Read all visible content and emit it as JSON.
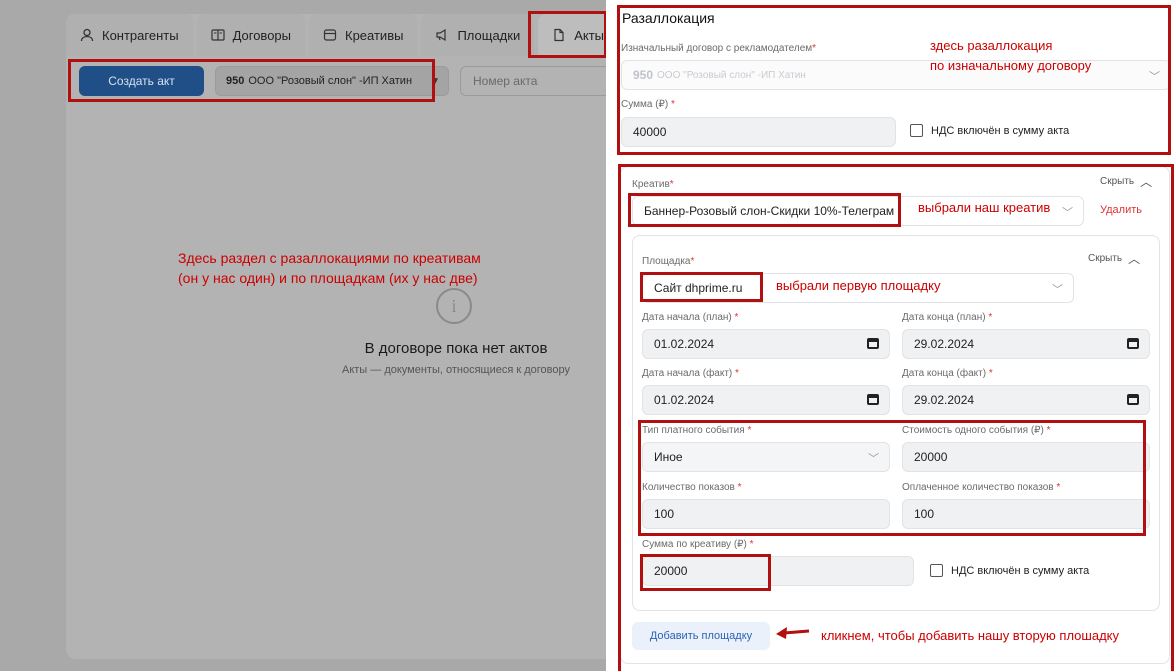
{
  "tabs": [
    {
      "label": "Контрагенты",
      "icon": "person-icon"
    },
    {
      "label": "Договоры",
      "icon": "book-icon"
    },
    {
      "label": "Креативы",
      "icon": "card-icon"
    },
    {
      "label": "Площадки",
      "icon": "megaphone-icon"
    },
    {
      "label": "Акты",
      "icon": "document-icon",
      "active": true
    }
  ],
  "toolbar": {
    "create_label": "Создать акт",
    "contract_id": "950",
    "contract_name": "ООО \"Розовый слон\" -ИП Хатин",
    "act_number_placeholder": "Номер акта"
  },
  "empty": {
    "title": "В договоре пока нет актов",
    "subtitle": "Акты — документы, относящиеся к договору"
  },
  "annotations": {
    "left": "Здесь раздел с разаллокациями по креативам\n(он у нас один) и по площадкам (их у нас две)",
    "top_right": "здесь разаллокация\nпо изначальному договору",
    "creative": "выбрали наш креатив",
    "platform": "выбрали первую площадку",
    "add": "кликнем, чтобы добавить нашу вторую плошадку"
  },
  "reallocation": {
    "title": "Разаллокация",
    "orig_contract_label": "Изначальный договор с рекламодателем",
    "orig_contract_id": "950",
    "orig_contract_name": "ООО \"Розовый слон\" -ИП Хатин",
    "sum_label": "Сумма (₽)",
    "sum_value": "40000",
    "vat_label": "НДС включён в сумму акта"
  },
  "creative": {
    "label": "Креатив",
    "value": "Баннер-Розовый слон-Скидки 10%-Телеграм",
    "hide_label": "Скрыть",
    "delete_label": "Удалить"
  },
  "platform": {
    "label": "Площадка",
    "value": "Сайт dhprime.ru",
    "hide_label": "Скрыть",
    "start_plan_label": "Дата начала (план)",
    "start_plan": "01.02.2024",
    "end_plan_label": "Дата конца (план)",
    "end_plan": "29.02.2024",
    "start_fact_label": "Дата начала (факт)",
    "start_fact": "01.02.2024",
    "end_fact_label": "Дата конца (факт)",
    "end_fact": "29.02.2024",
    "event_type_label": "Тип платного события",
    "event_type": "Иное",
    "event_cost_label": "Стоимость одного события (₽)",
    "event_cost": "20000",
    "impressions_label": "Количество показов",
    "impressions": "100",
    "paid_impressions_label": "Оплаченное количество показов",
    "paid_impressions": "100",
    "creative_sum_label": "Сумма по креативу (₽)",
    "creative_sum": "20000",
    "vat_label": "НДС включён в сумму акта"
  },
  "add_platform_label": "Добавить площадку",
  "required_mark": "*"
}
